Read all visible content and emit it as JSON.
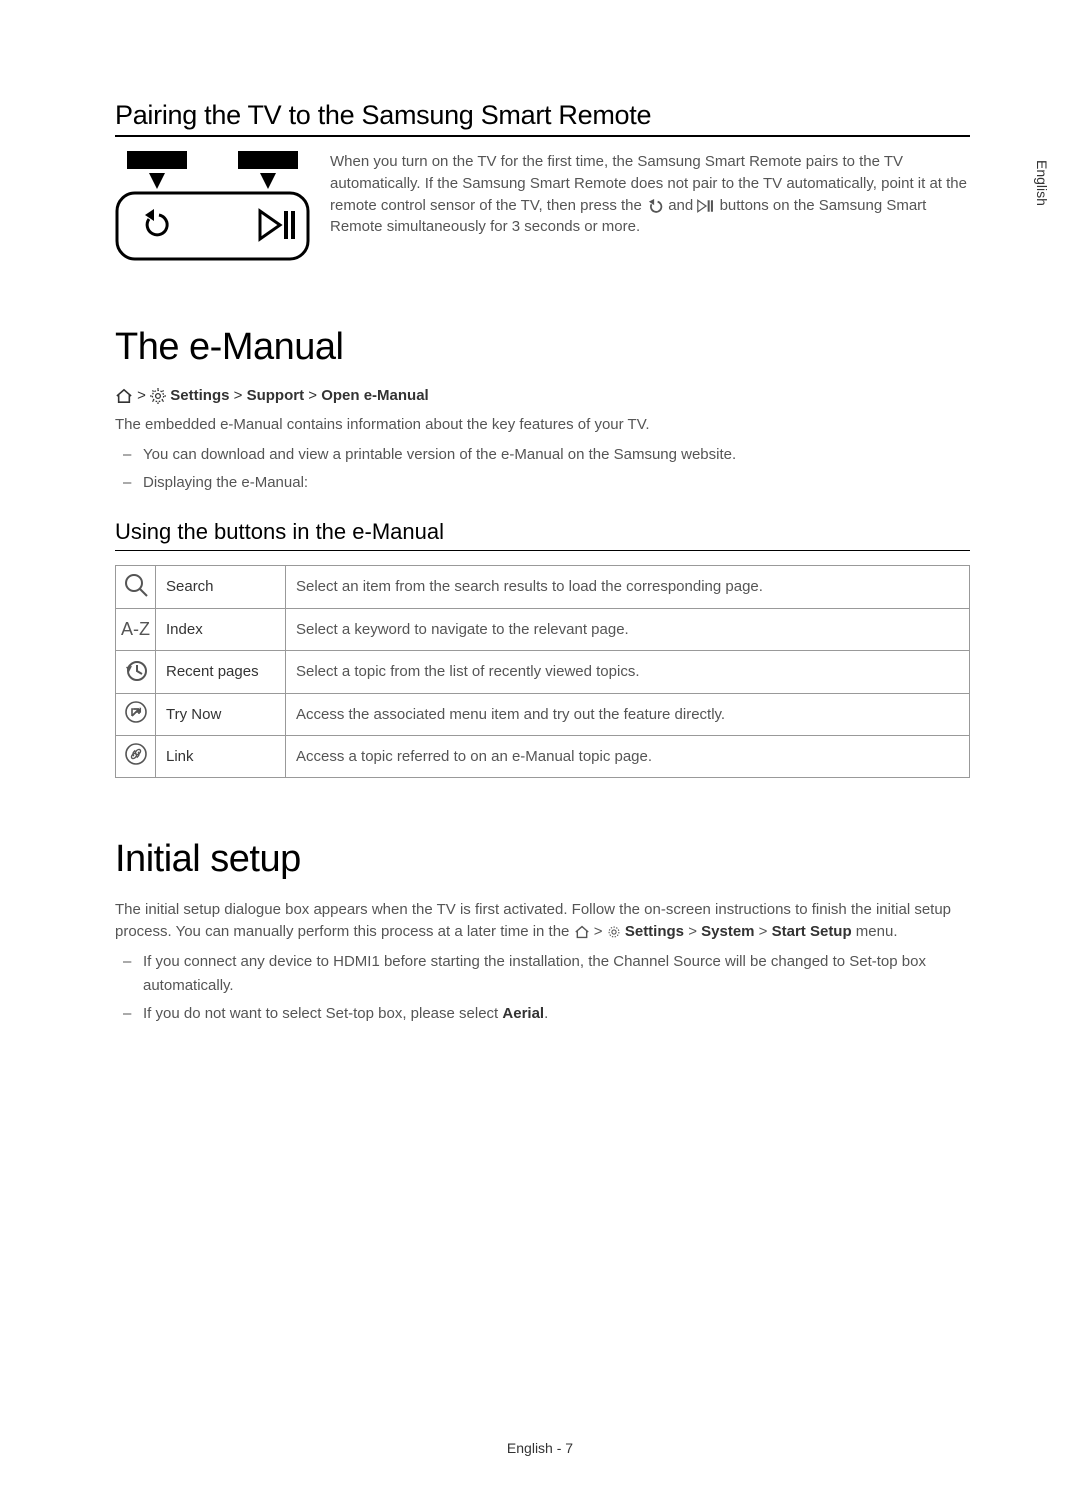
{
  "side_label": "English",
  "pairing": {
    "title": "Pairing the TV to the Samsung Smart Remote",
    "text_before": "When you turn on the TV for the first time, the Samsung Smart Remote pairs to the TV automatically. If the Samsung Smart Remote does not pair to the TV automatically, point it at the remote control sensor of the TV, then press the ",
    "text_mid": " and ",
    "text_after": " buttons on the Samsung Smart Remote simultaneously for 3 seconds or more."
  },
  "emanual": {
    "title": "The e-Manual",
    "crumb_parts": {
      "settings": "Settings",
      "support": "Support",
      "open": "Open e-Manual"
    },
    "description": "The embedded e-Manual contains information about the key features of your TV.",
    "bullets": [
      "You can download and view a printable version of the e-Manual on the Samsung website.",
      "Displaying the e-Manual:"
    ],
    "subsection": "Using the buttons in the e-Manual",
    "table": [
      {
        "icon": "search",
        "label": "Search",
        "desc": "Select an item from the search results to load the corresponding page."
      },
      {
        "icon": "index",
        "label": "Index",
        "desc": "Select a keyword to navigate to the relevant page."
      },
      {
        "icon": "recent",
        "label": "Recent pages",
        "desc": "Select a topic from the list of recently viewed topics."
      },
      {
        "icon": "trynow",
        "label": "Try Now",
        "desc": "Access the associated menu item and try out the feature directly."
      },
      {
        "icon": "link",
        "label": "Link",
        "desc": "Access a topic referred to on an e-Manual topic page."
      }
    ]
  },
  "initial": {
    "title": "Initial setup",
    "desc_before": "The initial setup dialogue box appears when the TV is first activated. Follow the on-screen instructions to finish the initial setup process. You can manually perform this process at a later time in the ",
    "crumb": {
      "settings": "Settings",
      "system": "System",
      "start": "Start Setup"
    },
    "desc_after": " menu.",
    "bullets": [
      "If you connect any device to HDMI1 before starting the installation, the Channel Source will be changed to Set-top box automatically.",
      "If you do not want to select Set-top box, please select Aerial."
    ],
    "aerial": "Aerial"
  },
  "footer": "English - 7"
}
